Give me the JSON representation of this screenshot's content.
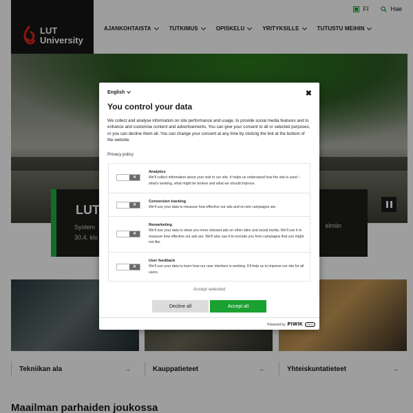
{
  "header": {
    "logo_line1": "LUT",
    "logo_line2": "University",
    "lang_switch": "FI",
    "search_label": "Hae",
    "nav": [
      "AJANKOHTAISTA",
      "TUTKIMUS",
      "OPISKELU",
      "YRITYKSILLE",
      "TUTUSTU MEIHIN"
    ]
  },
  "hero": {
    "heading": "LUT",
    "text_line1": "System",
    "text_line2": "30.4. klo",
    "text_right": "elmiin"
  },
  "categories": [
    {
      "label": "Tekniikan ala",
      "arrow": "→"
    },
    {
      "label": "Kauppatieteet",
      "arrow": "→"
    },
    {
      "label": "Yhteiskuntatieteet",
      "arrow": "→"
    }
  ],
  "section_title": "Maailman parhaiden joukossa",
  "consent": {
    "language": "English",
    "close": "✖",
    "title": "You control your data",
    "description": "We collect and analyse information on site performance and usage, to provide social media features and to enhance and customise content and advertisements. You can give your consent to all or selected purposes, or you can decline them all. You can change your consent at any time by clicking the link at the bottom of the website.",
    "privacy_link": "Privacy policy",
    "items": [
      {
        "name": "Analytics",
        "desc": "We'll collect information about your visit to our site. It helps us understand how the site is used – what's working, what might be broken and what we should improve.",
        "toggle": "✕"
      },
      {
        "name": "Conversion tracking",
        "desc": "We'll use your data to measure how effective our ads and on-site campaigns are.",
        "toggle": "✕"
      },
      {
        "name": "Remarketing",
        "desc": "We'll use your data to show you more relevant ads on other sites and social media. We'll use it to measure how effective our ads are. We'll also use it to exclude you from campaigns that you might not like.",
        "toggle": "✕"
      },
      {
        "name": "User feedback",
        "desc": "We'll use your data to learn how our user interface is working. It'll help us to improve our site for all users.",
        "toggle": "✕"
      }
    ],
    "accept_selected": "Accept selected",
    "decline_all": "Decline all",
    "accept_all": "Accept all",
    "powered_by": "Powered by",
    "powered_brand": "PIWIK",
    "powered_pro": "PRO"
  },
  "colors": {
    "accent": "#1aa130",
    "dark": "#151515"
  },
  "icons": [
    "lut-logo-icon",
    "globe-icon",
    "search-icon",
    "chevron-down-icon",
    "pause-icon",
    "arrow-right-icon",
    "close-icon"
  ]
}
